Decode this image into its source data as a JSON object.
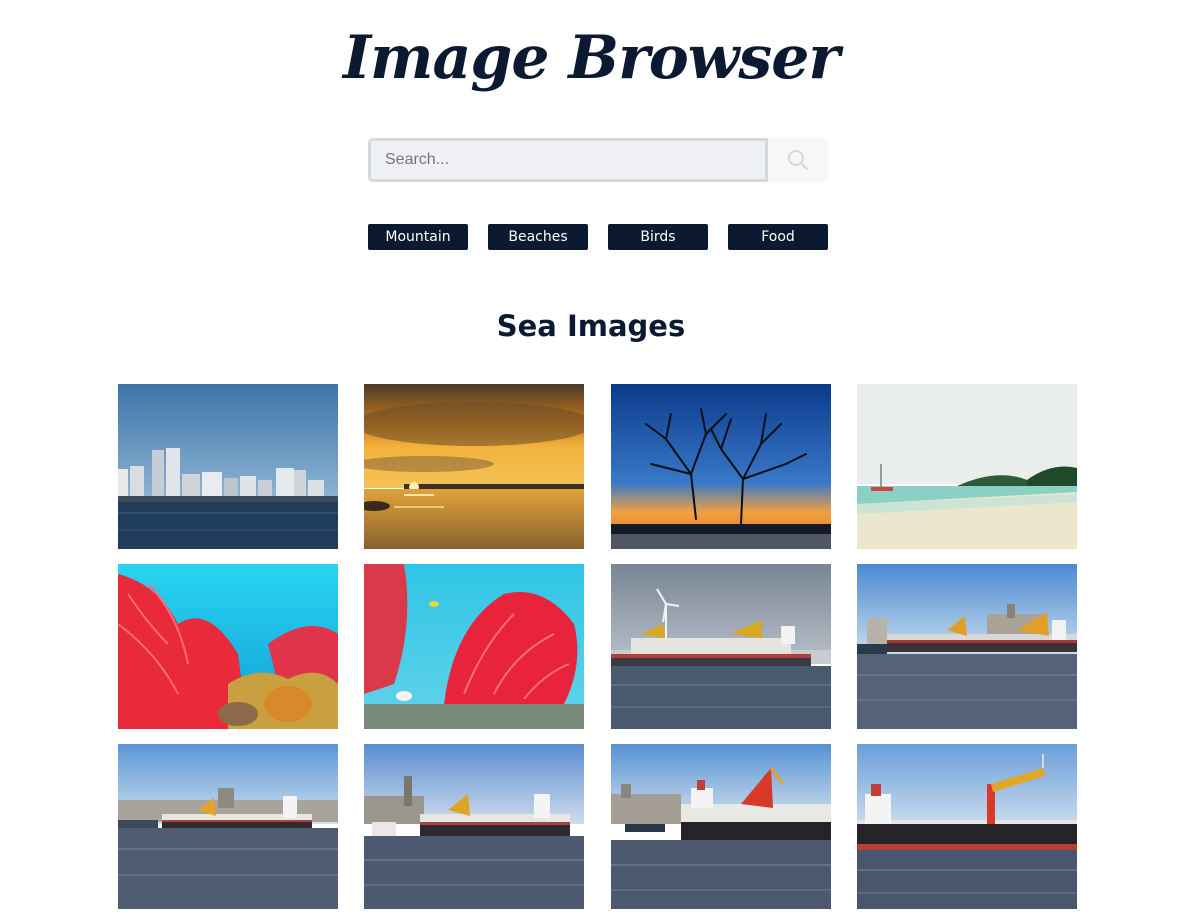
{
  "header": {
    "title": "Image Browser"
  },
  "search": {
    "placeholder": "Search...",
    "value": ""
  },
  "categories": [
    {
      "label": "Mountain"
    },
    {
      "label": "Beaches"
    },
    {
      "label": "Birds"
    },
    {
      "label": "Food"
    }
  ],
  "gallery": {
    "heading": "Sea Images",
    "images": [
      {
        "subject": "city skyline across the sea"
      },
      {
        "subject": "golden sunset over water"
      },
      {
        "subject": "bare trees silhouetted at dusk"
      },
      {
        "subject": "sandy beach with boat and islands"
      },
      {
        "subject": "red sea fan coral reef"
      },
      {
        "subject": "red coral with reef fish"
      },
      {
        "subject": "cargo ship with wind turbine"
      },
      {
        "subject": "cargo ship in harbour with tug"
      },
      {
        "subject": "cargo ship passing city waterfront"
      },
      {
        "subject": "cargo ship led by tug boat"
      },
      {
        "subject": "cargo ship near waterfront buildings"
      },
      {
        "subject": "cargo ship with cranes"
      }
    ]
  },
  "colors": {
    "primary": "#0b1a30",
    "search_bg": "#eef0f3"
  }
}
